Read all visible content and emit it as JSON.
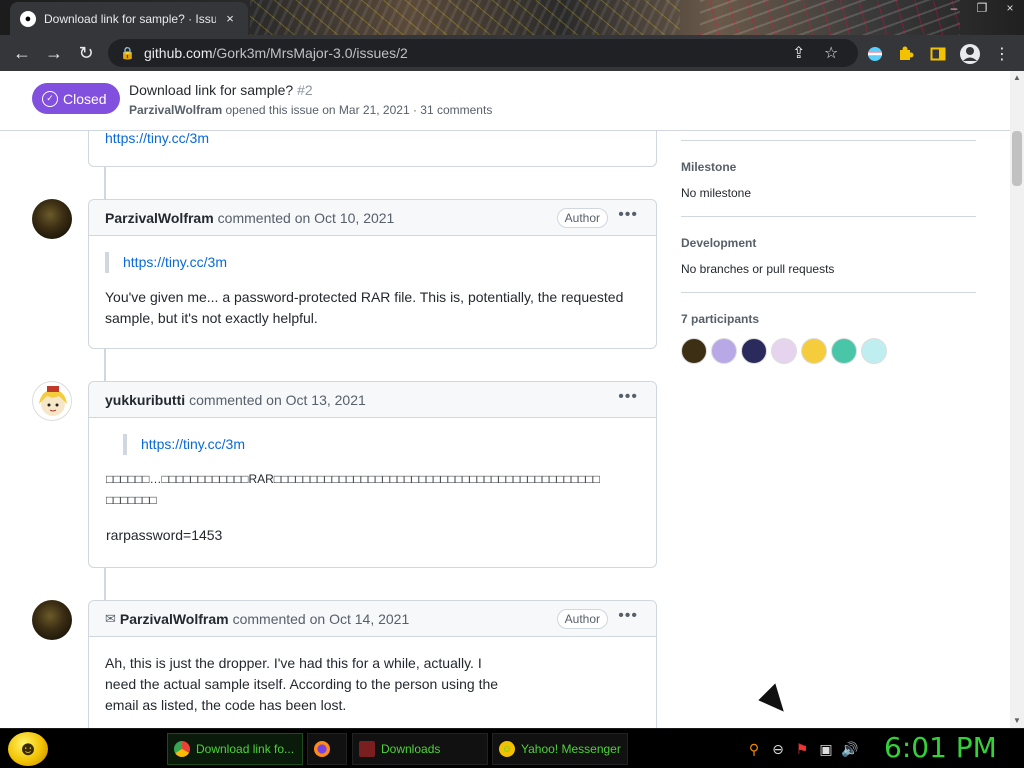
{
  "browser": {
    "tab_title": "Download link for sample? · Issu",
    "tab_close": "×",
    "url_domain": "github.com",
    "url_path": "/Gork3m/MrsMajor-3.0/issues/2",
    "window_controls": [
      "–",
      "❐",
      "×"
    ]
  },
  "issue": {
    "status": "Closed",
    "title": "Download link for sample?",
    "number": "#2",
    "author": "ParzivalWolfram",
    "meta_text": "opened this issue on Mar 21, 2021 · 31 comments"
  },
  "comments": [
    {
      "id": "prev",
      "body_link": "https://tiny.cc/3m"
    },
    {
      "id": "c1",
      "author": "ParzivalWolfram",
      "action": "commented on Oct 10, 2021",
      "badge": "Author",
      "quote_link": "https://tiny.cc/3m",
      "body": "You've given me... a password-protected RAR file. This is, potentially, the requested sample, but it's not exactly helpful."
    },
    {
      "id": "c2",
      "author": "yukkuributti",
      "action": "commented on Oct 13, 2021",
      "quote_link": "https://tiny.cc/3m",
      "body_jp": "□□□□□□…□□□□□□□□□□□□RAR□□□□□□□□□□□□□□□□□□□□□□□□□□□□□□□□□□□□□□□□□□□□□□□□□□□□",
      "body": "rarpassword=1453"
    },
    {
      "id": "c3",
      "author": "ParzivalWolfram",
      "action": "commented on Oct 14, 2021",
      "badge": "Author",
      "body": "Ah, this is just the dropper. I've had this for a while, actually. I need the actual sample itself. According to the person using the email as listed, the code has been lost."
    }
  ],
  "sidebar": {
    "milestone_title": "Milestone",
    "milestone_value": "No milestone",
    "development_title": "Development",
    "development_value": "No branches or pull requests",
    "participants_title": "7 participants",
    "participant_colors": [
      "#3d2f14",
      "#b9a8e6",
      "#2b2a5c",
      "#e6d4ee",
      "#f4cc3c",
      "#49c5a8",
      "#bfeef0"
    ]
  },
  "taskbar": {
    "tasks": [
      {
        "label": "Download link fo...",
        "icon": "chrome-icon"
      },
      {
        "label": "",
        "icon": "firefox-icon"
      },
      {
        "label": "Downloads",
        "icon": "downloads-icon"
      },
      {
        "label": "Yahoo! Messenger",
        "icon": "yahoo-messenger-icon"
      }
    ],
    "clock": "6:01 PM"
  }
}
